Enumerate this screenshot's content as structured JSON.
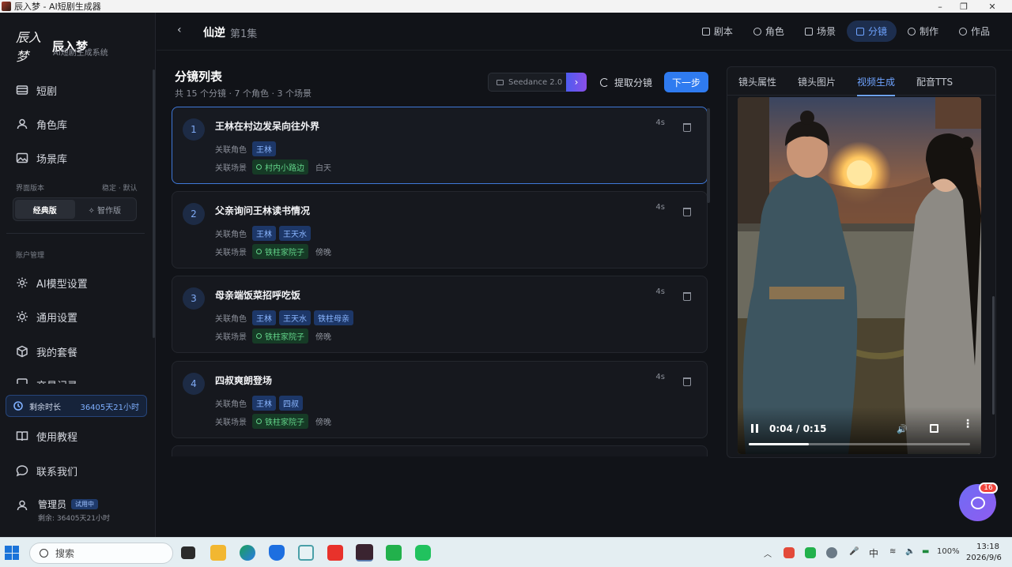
{
  "window": {
    "title": "辰入梦 - AI短剧生成器",
    "minimize": "–",
    "maximize": "❐",
    "close": "✕"
  },
  "sidebar": {
    "logo_text": "辰入梦",
    "brand_name": "辰入梦",
    "brand_sub": "AI短剧生成系统",
    "nav_top": [
      {
        "label": "短剧",
        "icon": "film-icon"
      },
      {
        "label": "角色库",
        "icon": "user-icon"
      },
      {
        "label": "场景库",
        "icon": "image-icon"
      }
    ],
    "version_label": "界面版本",
    "version_hint": "稳定 · 默认",
    "version_options": [
      "经典版",
      "✧ 智作版"
    ],
    "account_label": "账户管理",
    "nav_account": [
      {
        "label": "AI模型设置",
        "icon": "gear-icon"
      },
      {
        "label": "通用设置",
        "icon": "sun-gear-icon"
      },
      {
        "label": "我的套餐",
        "icon": "box-icon"
      },
      {
        "label": "交易记录",
        "icon": "receipt-icon"
      }
    ],
    "remain_label": "剩余时长",
    "remain_value": "36405天21小时",
    "nav_bottom": [
      {
        "label": "使用教程",
        "icon": "book-icon"
      },
      {
        "label": "联系我们",
        "icon": "chat-icon"
      }
    ],
    "admin_name": "管理员",
    "admin_tag": "试用中",
    "admin_remain": "剩余: 36405天21小时"
  },
  "header": {
    "back": "‹",
    "project": "仙逆",
    "episode": "第1集",
    "tabs": [
      {
        "label": "剧本",
        "active": false
      },
      {
        "label": "角色",
        "active": false
      },
      {
        "label": "场景",
        "active": false
      },
      {
        "label": "分镜",
        "active": true
      },
      {
        "label": "制作",
        "active": false
      },
      {
        "label": "作品",
        "active": false
      }
    ]
  },
  "list": {
    "title": "分镜列表",
    "subtitle": "共 15 个分镜 · 7 个角色 · 3 个场景",
    "model": "Seedance 2.0",
    "model_go": "›",
    "extract": "提取分镜",
    "next": "下一步",
    "role_label": "关联角色",
    "scene_label": "关联场景",
    "shots": [
      {
        "num": "1",
        "title": "王林在村边发呆向往外界",
        "dur": "4s",
        "roles": [
          "王林"
        ],
        "scene": "村内小路边",
        "time": "白天"
      },
      {
        "num": "2",
        "title": "父亲询问王林读书情况",
        "dur": "4s",
        "roles": [
          "王林",
          "王天水"
        ],
        "scene": "铁柱家院子",
        "time": "傍晚"
      },
      {
        "num": "3",
        "title": "母亲端饭菜招呼吃饭",
        "dur": "4s",
        "roles": [
          "王林",
          "王天水",
          "铁柱母亲"
        ],
        "scene": "铁柱家院子",
        "time": "傍晚"
      },
      {
        "num": "4",
        "title": "四叔爽朗登场",
        "dur": "4s",
        "roles": [
          "王林",
          "四叔"
        ],
        "scene": "铁柱家院子",
        "time": "傍晚"
      }
    ]
  },
  "panel": {
    "tabs": [
      {
        "label": "镜头属性",
        "active": false
      },
      {
        "label": "镜头图片",
        "active": false
      },
      {
        "label": "视频生成",
        "active": true
      },
      {
        "label": "配音TTS",
        "active": false
      }
    ],
    "video_time": "0:04 / 0:15",
    "progress": 0.27
  },
  "chat_badge": "16",
  "taskbar": {
    "search": "搜索",
    "lang": "中",
    "battery": "100%",
    "time": "13:18",
    "date": "2026/9/6"
  }
}
